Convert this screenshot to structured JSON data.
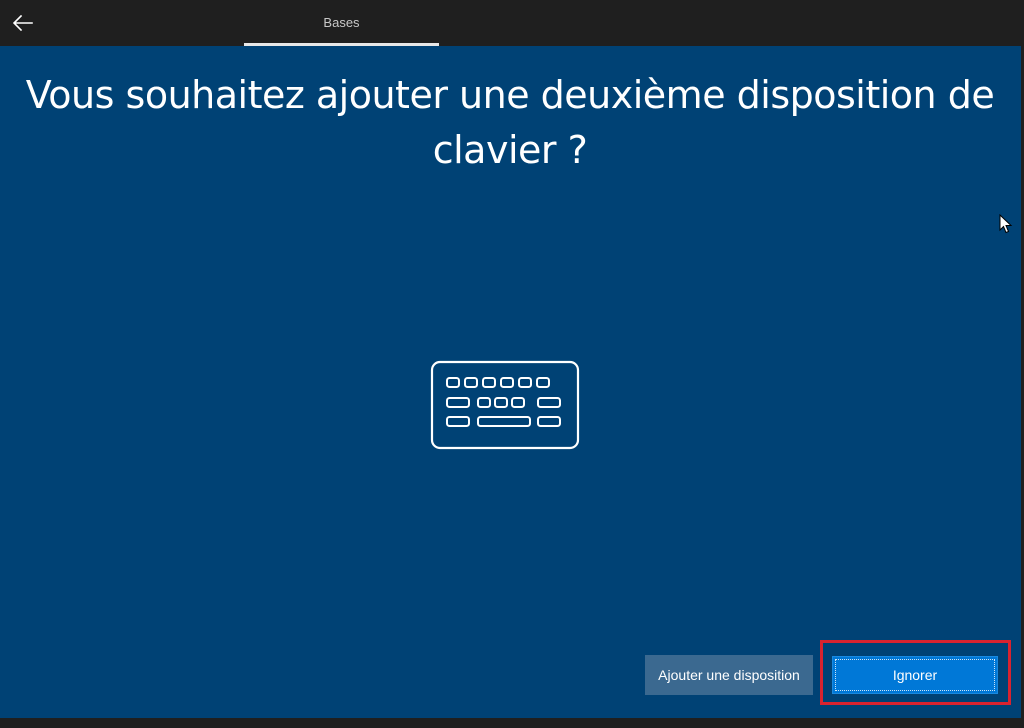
{
  "header": {
    "active_tab": "Bases"
  },
  "main": {
    "title": "Vous souhaitez ajouter une deuxième disposition de clavier ?",
    "illustration_icon": "keyboard-icon"
  },
  "actions": {
    "add_label": "Ajouter une disposition",
    "skip_label": "Ignorer"
  },
  "colors": {
    "background": "#004275",
    "topbar": "#1f1f1f",
    "primary_button": "#0078d7",
    "secondary_button": "#3b6990",
    "highlight": "#d9232f"
  }
}
